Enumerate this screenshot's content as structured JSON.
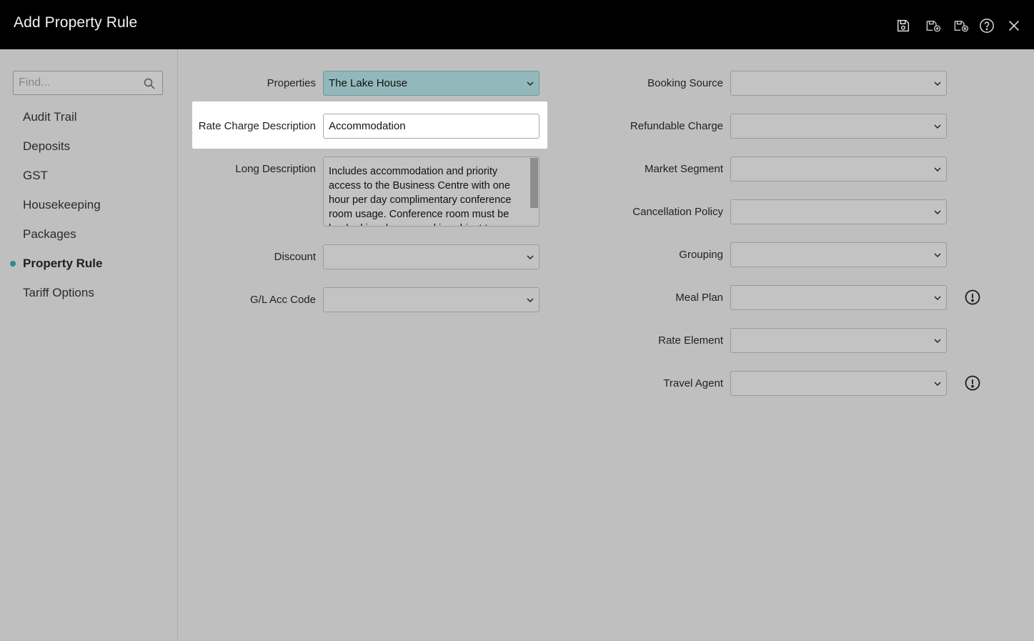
{
  "header": {
    "title": "Add Property Rule",
    "icons": [
      "save-icon",
      "save-and-new-icon",
      "save-and-close-icon",
      "help-icon",
      "close-icon"
    ]
  },
  "sidebar": {
    "search_placeholder": "Find...",
    "items": [
      {
        "label": "Audit Trail"
      },
      {
        "label": "Deposits"
      },
      {
        "label": "GST"
      },
      {
        "label": "Housekeeping"
      },
      {
        "label": "Packages"
      },
      {
        "label": "Property Rule",
        "active": true
      },
      {
        "label": "Tariff Options"
      }
    ]
  },
  "form_left": {
    "properties": {
      "label": "Properties",
      "value": "The Lake House"
    },
    "rate_charge_description": {
      "label": "Rate Charge Description",
      "value": "Accommodation"
    },
    "long_description": {
      "label": "Long Description",
      "value": "Includes accommodation and priority access to the Business Centre with one hour per day complimentary conference room usage. Conference room must be booked in advance and is subject to availability."
    },
    "discount": {
      "label": "Discount",
      "value": ""
    },
    "gl_acc_code": {
      "label": "G/L Acc Code",
      "value": ""
    }
  },
  "form_right": {
    "booking_source": {
      "label": "Booking Source",
      "value": ""
    },
    "refundable_charge": {
      "label": "Refundable Charge",
      "value": ""
    },
    "market_segment": {
      "label": "Market Segment",
      "value": ""
    },
    "cancellation_policy": {
      "label": "Cancellation Policy",
      "value": ""
    },
    "grouping": {
      "label": "Grouping",
      "value": ""
    },
    "meal_plan": {
      "label": "Meal Plan",
      "value": ""
    },
    "rate_element": {
      "label": "Rate Element",
      "value": ""
    },
    "travel_agent": {
      "label": "Travel Agent",
      "value": ""
    }
  },
  "colors": {
    "header_bg": "#000000",
    "page_bg": "#bfbfbf",
    "accent_teal": "#92b8bb",
    "active_dot": "#2a8a91"
  }
}
